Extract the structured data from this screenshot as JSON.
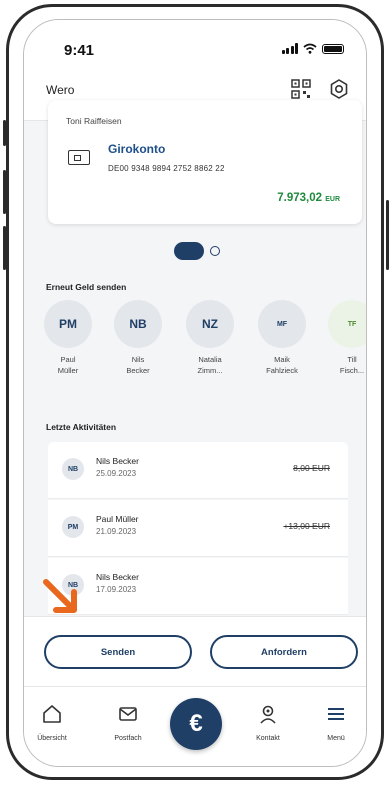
{
  "status_bar": {
    "time": "9:41"
  },
  "header": {
    "title": "Wero",
    "qr_icon": "qr-code-icon",
    "settings_icon": "settings-icon"
  },
  "account": {
    "holder": "Toni Raiffeisen",
    "name": "Girokonto",
    "iban": "DE00 9348 9894 2752 8862 22",
    "balance": "7.973,02",
    "currency": "EUR"
  },
  "sections": {
    "recent_send": "Erneut Geld senden",
    "recent_activity": "Letzte Aktivitäten"
  },
  "contacts": [
    {
      "initials": "PM",
      "name_line1": "Paul",
      "name_line2": "Müller"
    },
    {
      "initials": "NB",
      "name_line1": "Nils",
      "name_line2": "Becker"
    },
    {
      "initials": "NZ",
      "name_line1": "Natalia",
      "name_line2": "Zimm..."
    },
    {
      "initials": "MF",
      "name_line1": "Maik",
      "name_line2": "Fahlzieck"
    },
    {
      "initials": "TF",
      "name_line1": "Till",
      "name_line2": "Fisch..."
    }
  ],
  "activities": [
    {
      "initials": "NB",
      "name": "Nils Becker",
      "date": "25.09.2023",
      "amount": "8,00 EUR"
    },
    {
      "initials": "PM",
      "name": "Paul Müller",
      "date": "21.09.2023",
      "amount": "+13,00 EUR"
    },
    {
      "initials": "NB",
      "name": "Nils Becker",
      "date": "17.09.2023",
      "amount": ""
    }
  ],
  "actions": {
    "send_label": "Senden",
    "request_label": "Anfordern"
  },
  "tabbar": {
    "overview": "Übersicht",
    "mailbox": "Postfach",
    "center_symbol": "€",
    "contact": "Kontakt",
    "menu": "Menü"
  },
  "colors": {
    "primary": "#1f3f66",
    "balance_green": "#1e8a3c",
    "amount_red": "#c8363a",
    "arrow_orange": "#e8681e"
  }
}
